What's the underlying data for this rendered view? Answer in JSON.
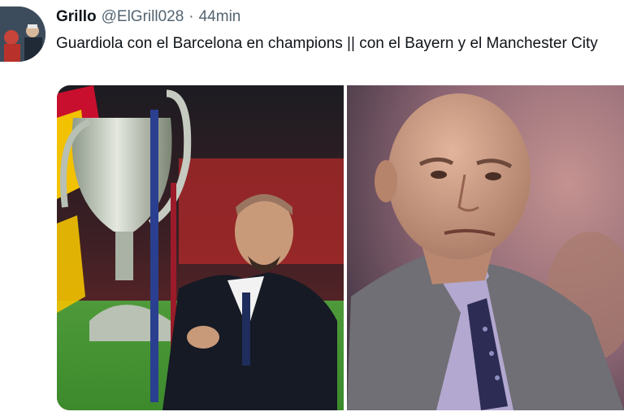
{
  "tweet": {
    "display_name": "Grillo",
    "handle": "@ElGrill028",
    "separator": "·",
    "time": "44min",
    "text": "Guardiola con el Barcelona en champions || con el Bayern y el Manchester City"
  },
  "media": {
    "photos": [
      {
        "icon": "photo-coach-with-trophy"
      },
      {
        "icon": "photo-bald-man-in-suit"
      }
    ]
  },
  "colors": {
    "text_primary": "#0f1419",
    "text_secondary": "#536471",
    "background": "#ffffff"
  }
}
